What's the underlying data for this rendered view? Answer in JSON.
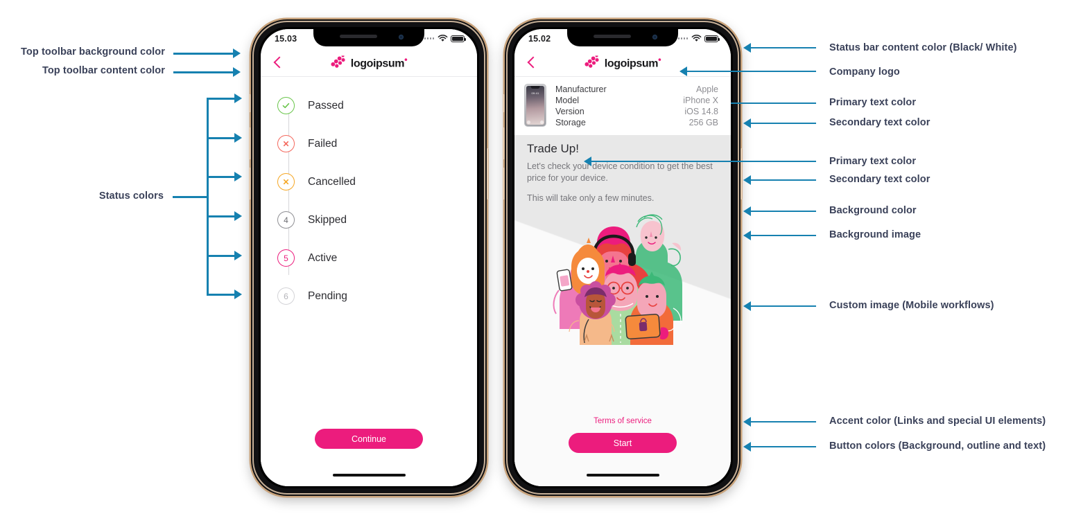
{
  "colors": {
    "accent": "#ec1c7d",
    "annotation_line": "#1681b0",
    "annotation_text": "#3a4159",
    "status_passed": "#69c54a",
    "status_failed": "#f4675c",
    "status_cancelled": "#f5a623",
    "status_skipped": "#8e8e93",
    "status_active": "#ec1c7d",
    "status_pending": "#c9c9cd",
    "primary_text": "#2b2b30",
    "secondary_text": "#8d8d92",
    "background": "#f2f2f2"
  },
  "annotations": {
    "left": [
      {
        "label": "Top toolbar background color"
      },
      {
        "label": "Top toolbar content color"
      },
      {
        "label": "Status colors"
      }
    ],
    "right": [
      {
        "label": "Status bar content color (Black/ White)"
      },
      {
        "label": "Company logo"
      },
      {
        "label": "Primary text color"
      },
      {
        "label": "Secondary text color"
      },
      {
        "label": "Primary text color"
      },
      {
        "label": "Secondary text color"
      },
      {
        "label": "Background color"
      },
      {
        "label": "Background image"
      },
      {
        "label": "Custom image (Mobile workflows)"
      },
      {
        "label": "Accent color (Links and special UI elements)"
      },
      {
        "label": "Button colors (Background, outline and text)"
      }
    ]
  },
  "phone_left": {
    "status_bar": {
      "time": "15.03",
      "wifi_icon": "wifi-icon",
      "battery_icon": "battery-icon",
      "signal_icon": "signal-dots-icon"
    },
    "toolbar": {
      "back_icon": "chevron-left-icon",
      "logo_mark": "logoipsum-mark-icon",
      "logo_text": "logoipsum",
      "logo_dot": "•"
    },
    "list": [
      {
        "badge": "check-icon",
        "badge_text": "",
        "label": "Passed",
        "color": "#69c54a"
      },
      {
        "badge": "close-icon",
        "badge_text": "",
        "label": "Failed",
        "color": "#f4675c"
      },
      {
        "badge": "close-icon",
        "badge_text": "",
        "label": "Cancelled",
        "color": "#f5a623"
      },
      {
        "badge": "number",
        "badge_text": "4",
        "label": "Skipped",
        "color": "#8e8e93"
      },
      {
        "badge": "number",
        "badge_text": "5",
        "label": "Active",
        "color": "#ec1c7d"
      },
      {
        "badge": "number",
        "badge_text": "6",
        "label": "Pending",
        "color": "#c9c9cd"
      }
    ],
    "cta": {
      "label": "Continue"
    }
  },
  "phone_right": {
    "status_bar": {
      "time": "15.02",
      "wifi_icon": "wifi-icon",
      "battery_icon": "battery-icon",
      "signal_icon": "signal-dots-icon"
    },
    "toolbar": {
      "back_icon": "chevron-left-icon",
      "logo_mark": "logoipsum-mark-icon",
      "logo_text": "logoipsum",
      "logo_dot": "•"
    },
    "device": {
      "thumbnail": "iphone-x-photo",
      "thumb_time": "09:41",
      "specs": [
        {
          "key": "Manufacturer",
          "value": "Apple"
        },
        {
          "key": "Model",
          "value": "iPhone X"
        },
        {
          "key": "Version",
          "value": "iOS 14.8"
        },
        {
          "key": "Storage",
          "value": "256 GB"
        }
      ]
    },
    "title": "Trade Up!",
    "paragraph_1": "Let's check your device condition to get the best price for your device.",
    "paragraph_2": "This will take only a few minutes.",
    "illustration": "group-of-people-illustration",
    "terms_link": "Terms of service",
    "cta": {
      "label": "Start"
    }
  }
}
